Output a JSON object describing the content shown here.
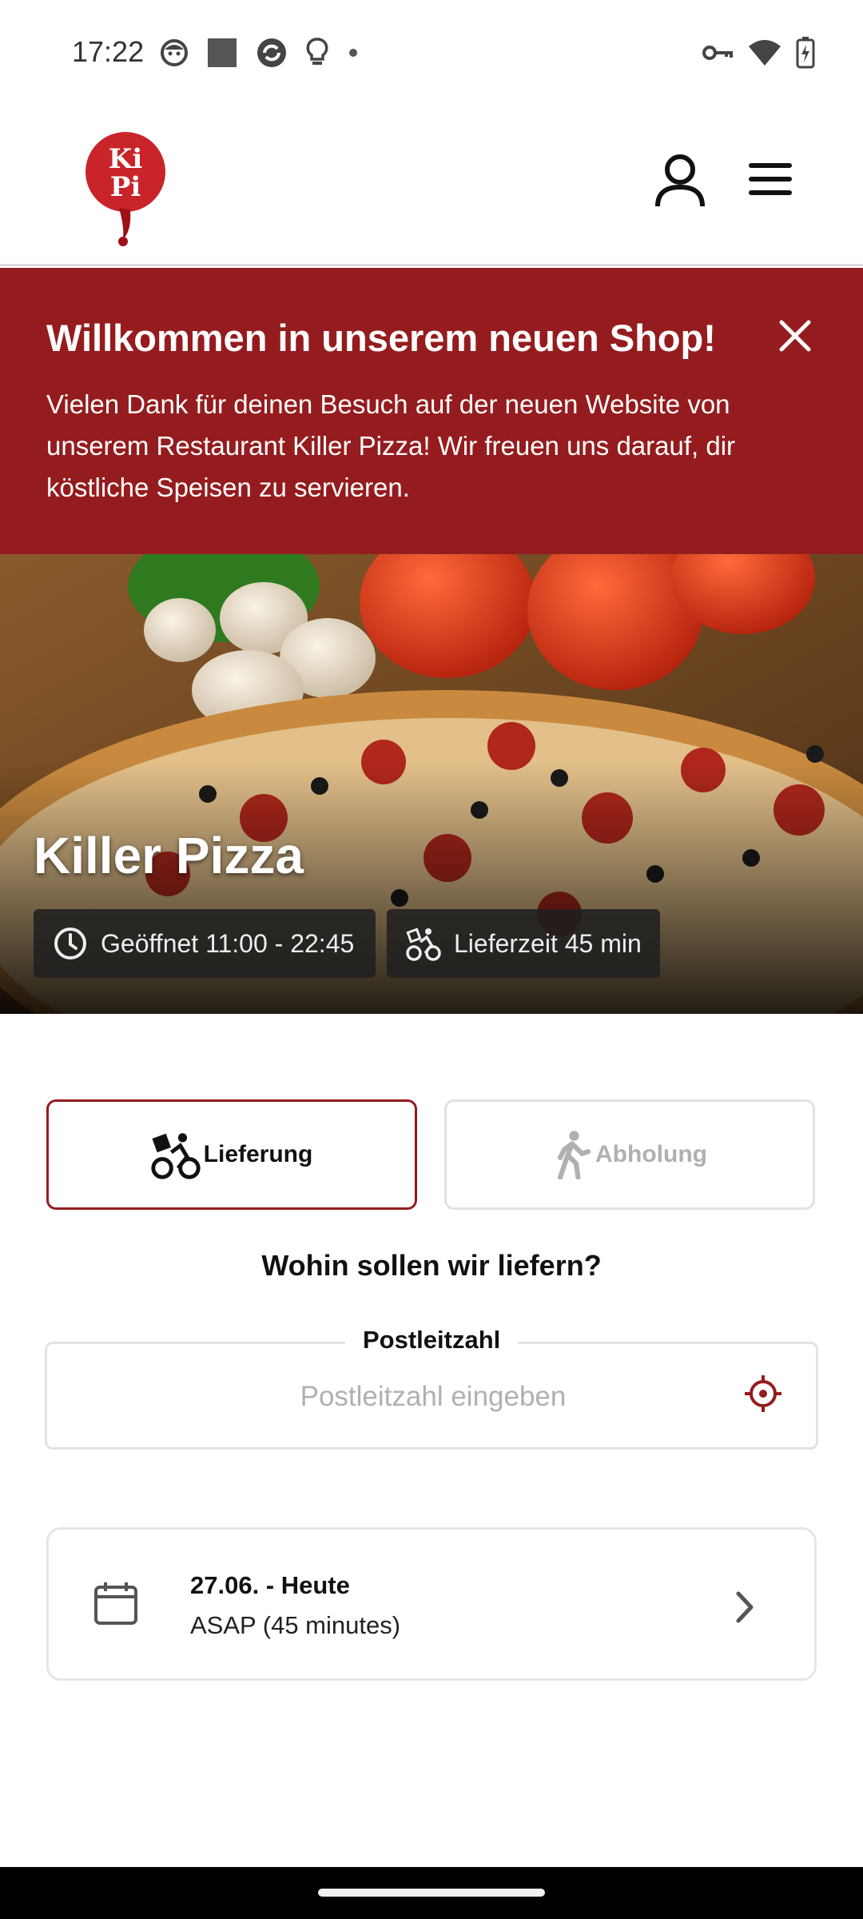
{
  "status_bar": {
    "time": "17:22",
    "left_icons": [
      "face-icon",
      "square-icon",
      "sync-icon",
      "bulb-icon",
      "dot-icon"
    ],
    "right_icons": [
      "key-icon",
      "wifi-icon",
      "battery-charging-icon"
    ]
  },
  "header": {
    "logo_text_line1": "Ki",
    "logo_text_line2": "Pi",
    "brand_color": "#951c1e"
  },
  "banner": {
    "title": "Willkommen in unserem neuen Shop!",
    "text": "Vielen Dank für deinen Besuch auf der neuen Website von unserem Restaurant Killer Pizza! Wir freuen uns darauf, dir köstliche Speisen zu servieren."
  },
  "hero": {
    "restaurant_name": "Killer Pizza",
    "opening_hours": "Geöffnet 11:00 - 22:45",
    "delivery_time": "Lieferzeit 45 min"
  },
  "order_mode": {
    "delivery_label": "Lieferung",
    "pickup_label": "Abholung",
    "selected": "Lieferung"
  },
  "delivery": {
    "question": "Wohin sollen wir liefern?",
    "zip_label": "Postleitzahl",
    "zip_placeholder": "Postleitzahl eingeben",
    "zip_value": ""
  },
  "schedule": {
    "date": "27.06. - Heute",
    "time": "ASAP (45 minutes)"
  }
}
